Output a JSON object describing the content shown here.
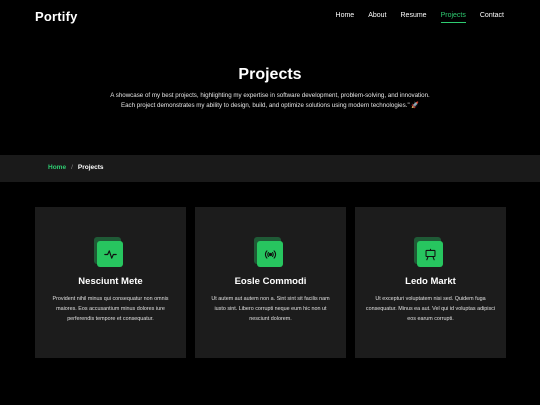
{
  "header": {
    "logo": "Portify",
    "nav": [
      {
        "label": "Home",
        "active": false
      },
      {
        "label": "About",
        "active": false
      },
      {
        "label": "Resume",
        "active": false
      },
      {
        "label": "Projects",
        "active": true
      },
      {
        "label": "Contact",
        "active": false
      }
    ]
  },
  "hero": {
    "title": "Projects",
    "description": "A showcase of my best projects, highlighting my expertise in software development, problem-solving, and innovation. Each project demonstrates my ability to design, build, and optimize solutions using modern technologies.\" 🚀"
  },
  "breadcrumb": {
    "home": "Home",
    "separator": "/",
    "current": "Projects"
  },
  "cards": [
    {
      "icon": "activity-icon",
      "title": "Nesciunt Mete",
      "description": "Provident nihil minus qui consequatur non omnis maiores. Eos accusantium minus dolores iure perferendis tempore et consequatur."
    },
    {
      "icon": "broadcast-icon",
      "title": "Eosle Commodi",
      "description": "Ut autem aut autem non a. Sint sint sit facilis nam iusto sint. Libero corrupti neque eum hic non ut nesciunt dolorem."
    },
    {
      "icon": "easel-icon",
      "title": "Ledo Markt",
      "description": "Ut excepturi voluptatem nisi sed. Quidem fuga consequatur. Minus ea aut. Vel qui id voluptas adipisci eos earum corrupti."
    }
  ],
  "colors": {
    "accent": "#27c55f",
    "background": "#000000",
    "card": "#1c1c1c",
    "bar": "#1a1a1a"
  }
}
